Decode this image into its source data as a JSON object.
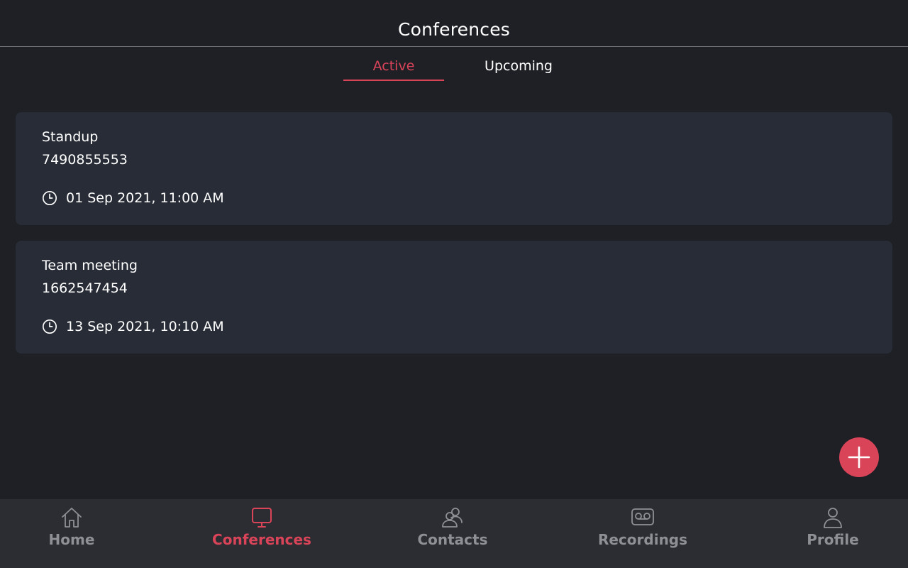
{
  "header": {
    "title": "Conferences"
  },
  "tabs": [
    {
      "label": "Active",
      "selected": true
    },
    {
      "label": "Upcoming",
      "selected": false
    }
  ],
  "conferences": [
    {
      "name": "Standup",
      "number": "7490855553",
      "datetime": "01 Sep 2021, 11:00 AM"
    },
    {
      "name": "Team meeting",
      "number": "1662547454",
      "datetime": "13 Sep 2021, 10:10 AM"
    }
  ],
  "fab": {
    "icon": "plus-icon",
    "color": "#d94459"
  },
  "bottom_nav": [
    {
      "label": "Home",
      "icon": "home-icon",
      "active": false
    },
    {
      "label": "Conferences",
      "icon": "monitor-icon",
      "active": true
    },
    {
      "label": "Contacts",
      "icon": "contacts-icon",
      "active": false
    },
    {
      "label": "Recordings",
      "icon": "voicemail-icon",
      "active": false
    },
    {
      "label": "Profile",
      "icon": "user-icon",
      "active": false
    }
  ],
  "colors": {
    "accent": "#d94459",
    "background": "#1f2026",
    "card": "#272c36",
    "nav_background": "#2b2d33",
    "nav_inactive": "#8e9096"
  }
}
